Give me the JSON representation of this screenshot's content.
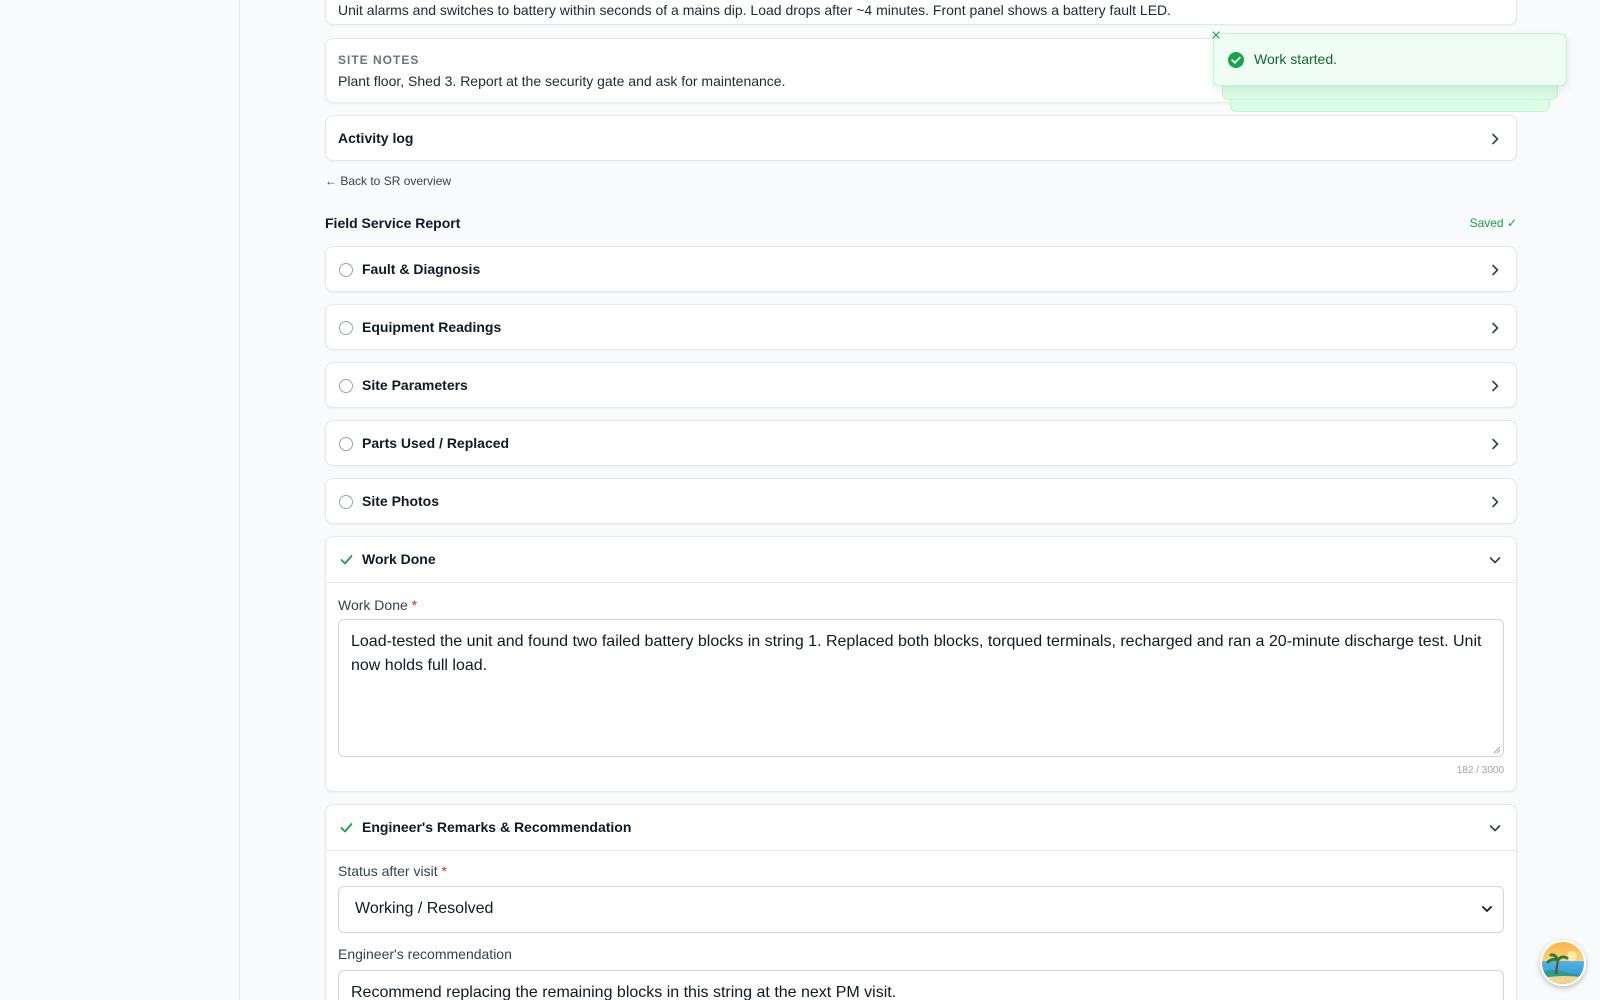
{
  "symptom_text": "Unit alarms and switches to battery within seconds of a mains dip. Load drops after ~4 minutes. Front panel shows a battery fault LED.",
  "site_notes": {
    "label": "SITE NOTES",
    "text": "Plant floor, Shed 3. Report at the security gate and ask for maintenance."
  },
  "activity_log_label": "Activity log",
  "back_link": "← Back to SR overview",
  "report": {
    "title": "Field Service Report",
    "saved_label": "Saved ✓",
    "sections": [
      {
        "label": "Fault & Diagnosis",
        "complete": false
      },
      {
        "label": "Equipment Readings",
        "complete": false
      },
      {
        "label": "Site Parameters",
        "complete": false
      },
      {
        "label": "Parts Used / Replaced",
        "complete": false
      },
      {
        "label": "Site Photos",
        "complete": false
      }
    ],
    "work_done": {
      "section_label": "Work Done",
      "field_label": "Work Done",
      "required_mark": "*",
      "value": "Load-tested the unit and found two failed battery blocks in string 1. Replaced both blocks, torqued terminals, recharged and ran a 20-minute discharge test. Unit now holds full load.",
      "counter": "182 / 3000"
    },
    "remarks": {
      "section_label": "Engineer's Remarks & Recommendation",
      "status_label": "Status after visit",
      "required_mark": "*",
      "status_value": "Working / Resolved",
      "recommendation_label": "Engineer's recommendation",
      "recommendation_value": "Recommend replacing the remaining blocks in this string at the next PM visit."
    }
  },
  "toast": {
    "message": "Work started."
  },
  "colors": {
    "success": "#16a34a",
    "required": "#dc2626",
    "toast_bg": "#f0fdf4"
  }
}
